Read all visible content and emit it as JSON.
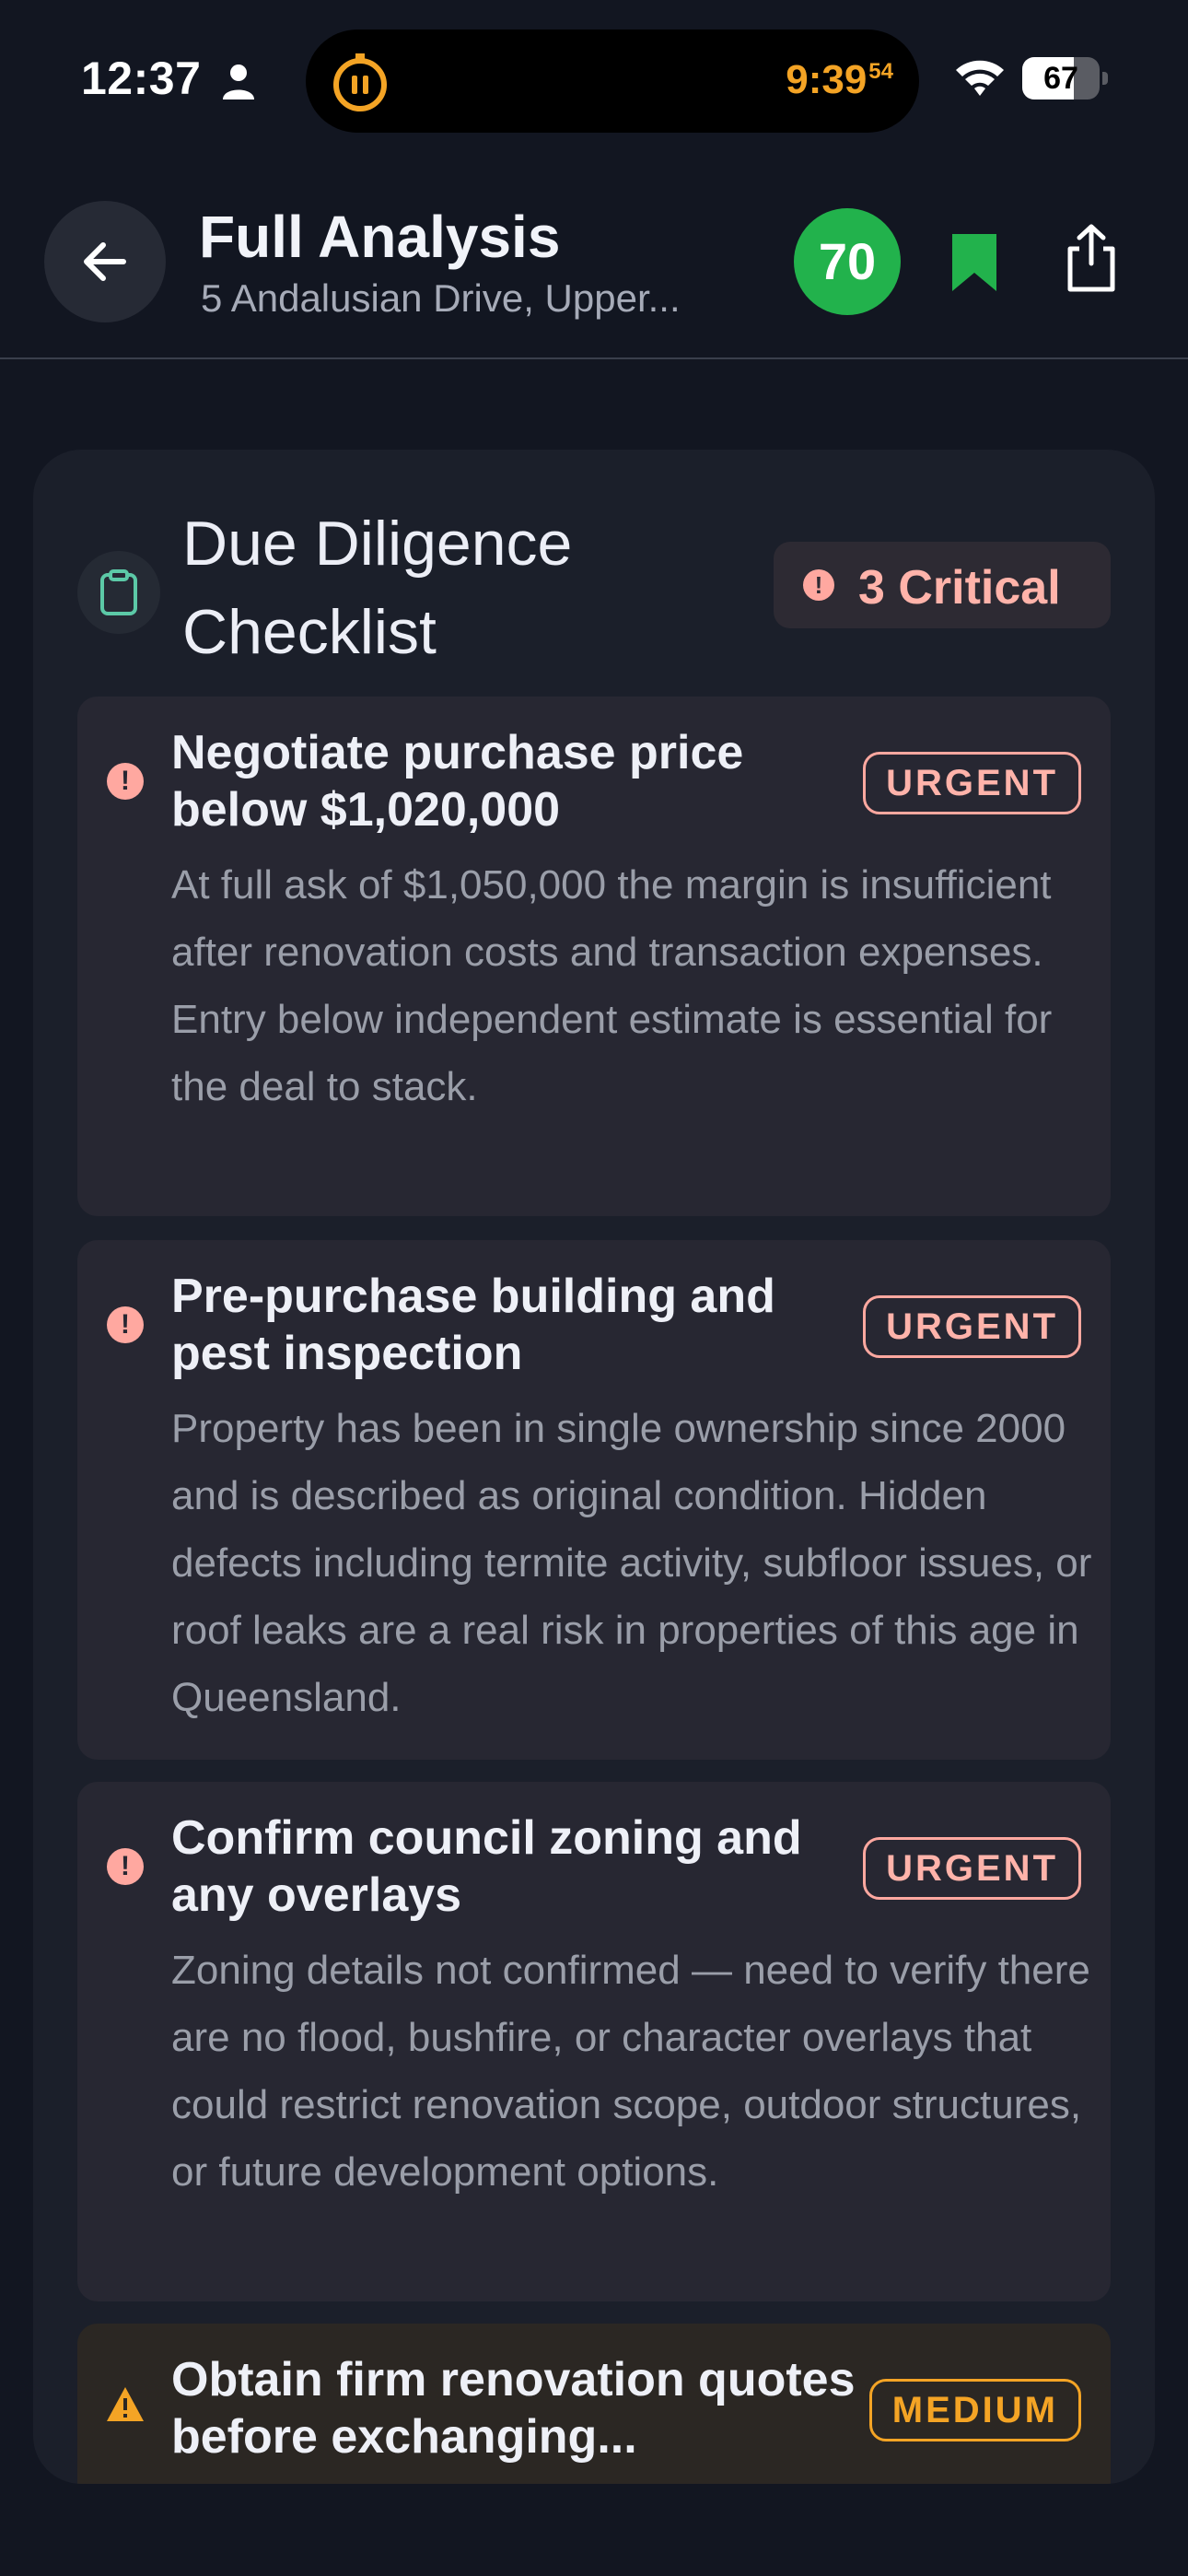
{
  "status_bar": {
    "time": "12:37",
    "island_clock": "9:39",
    "island_clock_seconds": "54",
    "battery_level": 67,
    "battery_text": "67"
  },
  "header": {
    "title": "Full Analysis",
    "subtitle": "5 Andalusian Drive, Upper...",
    "score": "70",
    "score_color": "#22b24c"
  },
  "checklist": {
    "title": "Due Diligence Checklist",
    "critical_label": "3 Critical",
    "items": [
      {
        "title": "Negotiate purchase price below $1,020,000",
        "badge": "URGENT",
        "body": "At full ask of $1,050,000 the margin is insufficient after renovation costs and transaction expenses. Entry below independent estimate is essential for the deal to stack."
      },
      {
        "title": "Pre-purchase building and pest inspection",
        "badge": "URGENT",
        "body": "Property has been in single ownership since 2000 and is described as original condition. Hidden defects including termite activity, subfloor issues, or roof leaks are a real risk in properties of this age in Queensland."
      },
      {
        "title": "Confirm council zoning and any overlays",
        "badge": "URGENT",
        "body": "Zoning details not confirmed — need to verify there are no flood, bushfire, or character overlays that could restrict renovation scope, outdoor structures, or future development options."
      },
      {
        "title": "Obtain firm renovation quotes before exchanging...",
        "badge": "MEDIUM",
        "body": ""
      }
    ]
  },
  "colors": {
    "background": "#121621",
    "card": "#1b1f2a",
    "urgent": "#ffa8a0",
    "medium": "#f4a425",
    "bookmark": "#22b24c"
  }
}
